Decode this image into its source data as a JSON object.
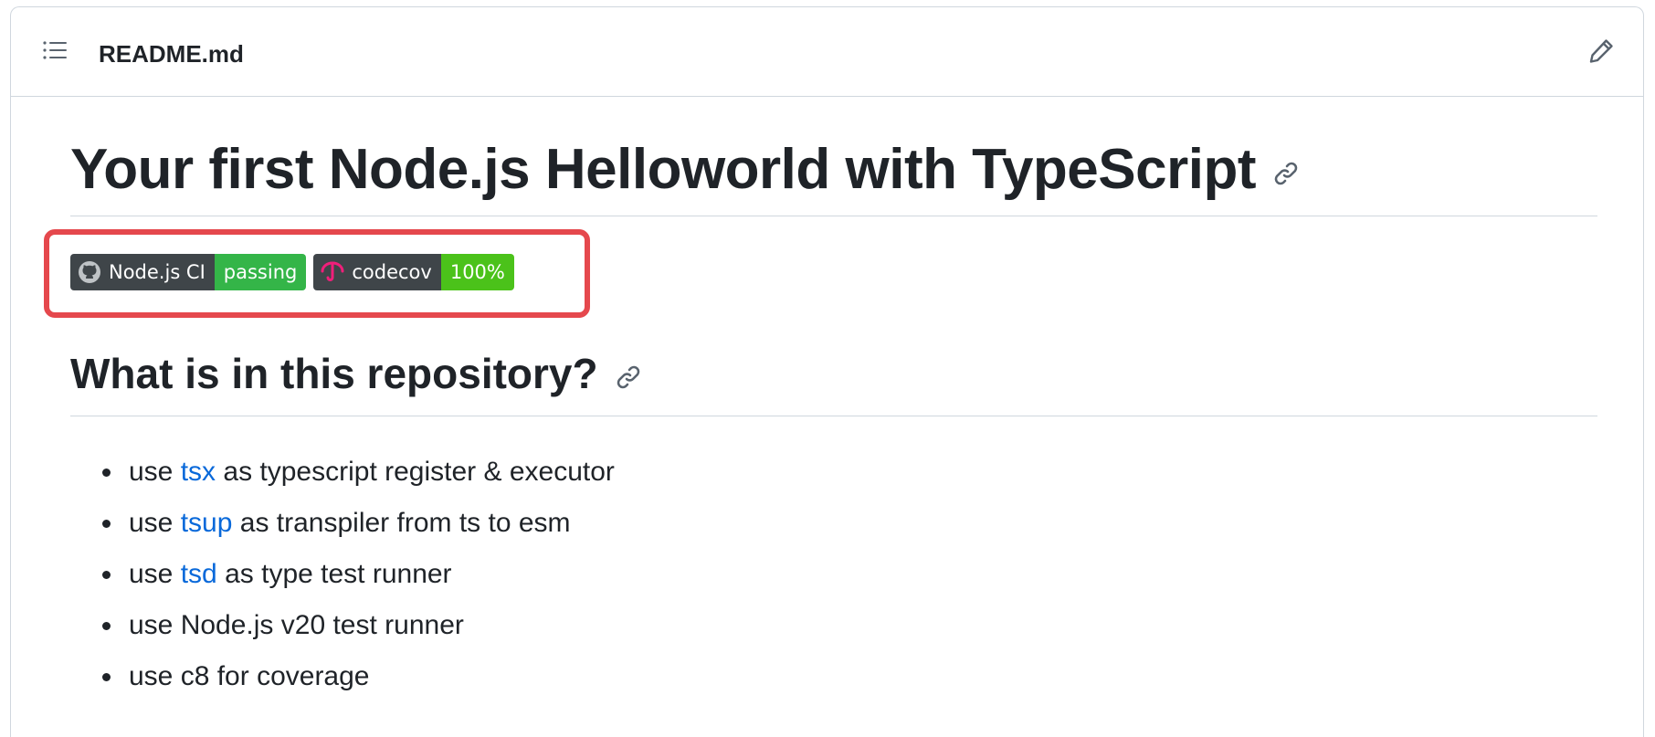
{
  "header": {
    "file_name": "README.md",
    "toc_icon": "list-unordered-icon",
    "edit_icon": "pencil-icon"
  },
  "readme": {
    "title": "Your first Node.js Helloworld with TypeScript",
    "badges": [
      {
        "label": "Node.js CI",
        "status": "passing",
        "icon": "github-icon",
        "status_color": "#34b548"
      },
      {
        "label": "codecov",
        "status": "100%",
        "icon": "codecov-umbrella-icon",
        "status_color": "#4bc21a"
      }
    ],
    "section_heading": "What is in this repository?",
    "items": [
      {
        "prefix": "use ",
        "link": "tsx",
        "suffix": " as typescript register & executor"
      },
      {
        "prefix": "use ",
        "link": "tsup",
        "suffix": " as transpiler from ts to esm"
      },
      {
        "prefix": "use ",
        "link": "tsd",
        "suffix": " as type test runner"
      },
      {
        "text": "use Node.js v20 test runner"
      },
      {
        "text": "use c8 for coverage"
      }
    ]
  },
  "colors": {
    "link": "#0969da",
    "highlight": "#e5484d",
    "badge_dark": "#3f4549"
  }
}
